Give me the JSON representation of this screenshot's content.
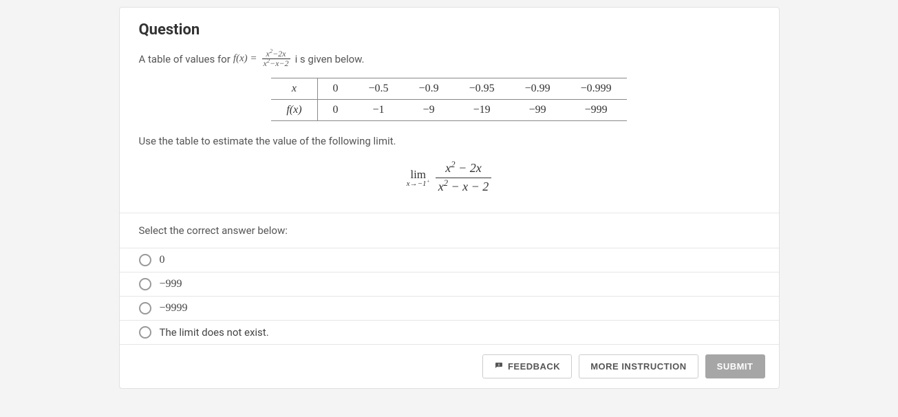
{
  "heading": "Question",
  "prompt": {
    "prefix": "A table of values for",
    "func_lhs": "f(x) =",
    "frac_num": "x² − 2x",
    "frac_den": "x² − x − 2",
    "suffix": "i s given below."
  },
  "table": {
    "row_labels": [
      "x",
      "f(x)"
    ],
    "x_values": [
      "0",
      "−0.5",
      "−0.9",
      "−0.95",
      "−0.99",
      "−0.999"
    ],
    "f_values": [
      "0",
      "−1",
      "−9",
      "−19",
      "−99",
      "−999"
    ]
  },
  "instruction": "Use the table to estimate the value of the following limit.",
  "limit": {
    "lim_word": "lim",
    "approach": "x→−1⁺",
    "num": "x² − 2x",
    "den": "x² − x − 2"
  },
  "select_prompt": "Select the correct answer below:",
  "options": [
    {
      "label": "0",
      "plain": false
    },
    {
      "label": "−999",
      "plain": false
    },
    {
      "label": "−9999",
      "plain": false
    },
    {
      "label": "The limit does not exist.",
      "plain": true
    }
  ],
  "buttons": {
    "feedback": "FEEDBACK",
    "more": "MORE INSTRUCTION",
    "submit": "SUBMIT"
  }
}
